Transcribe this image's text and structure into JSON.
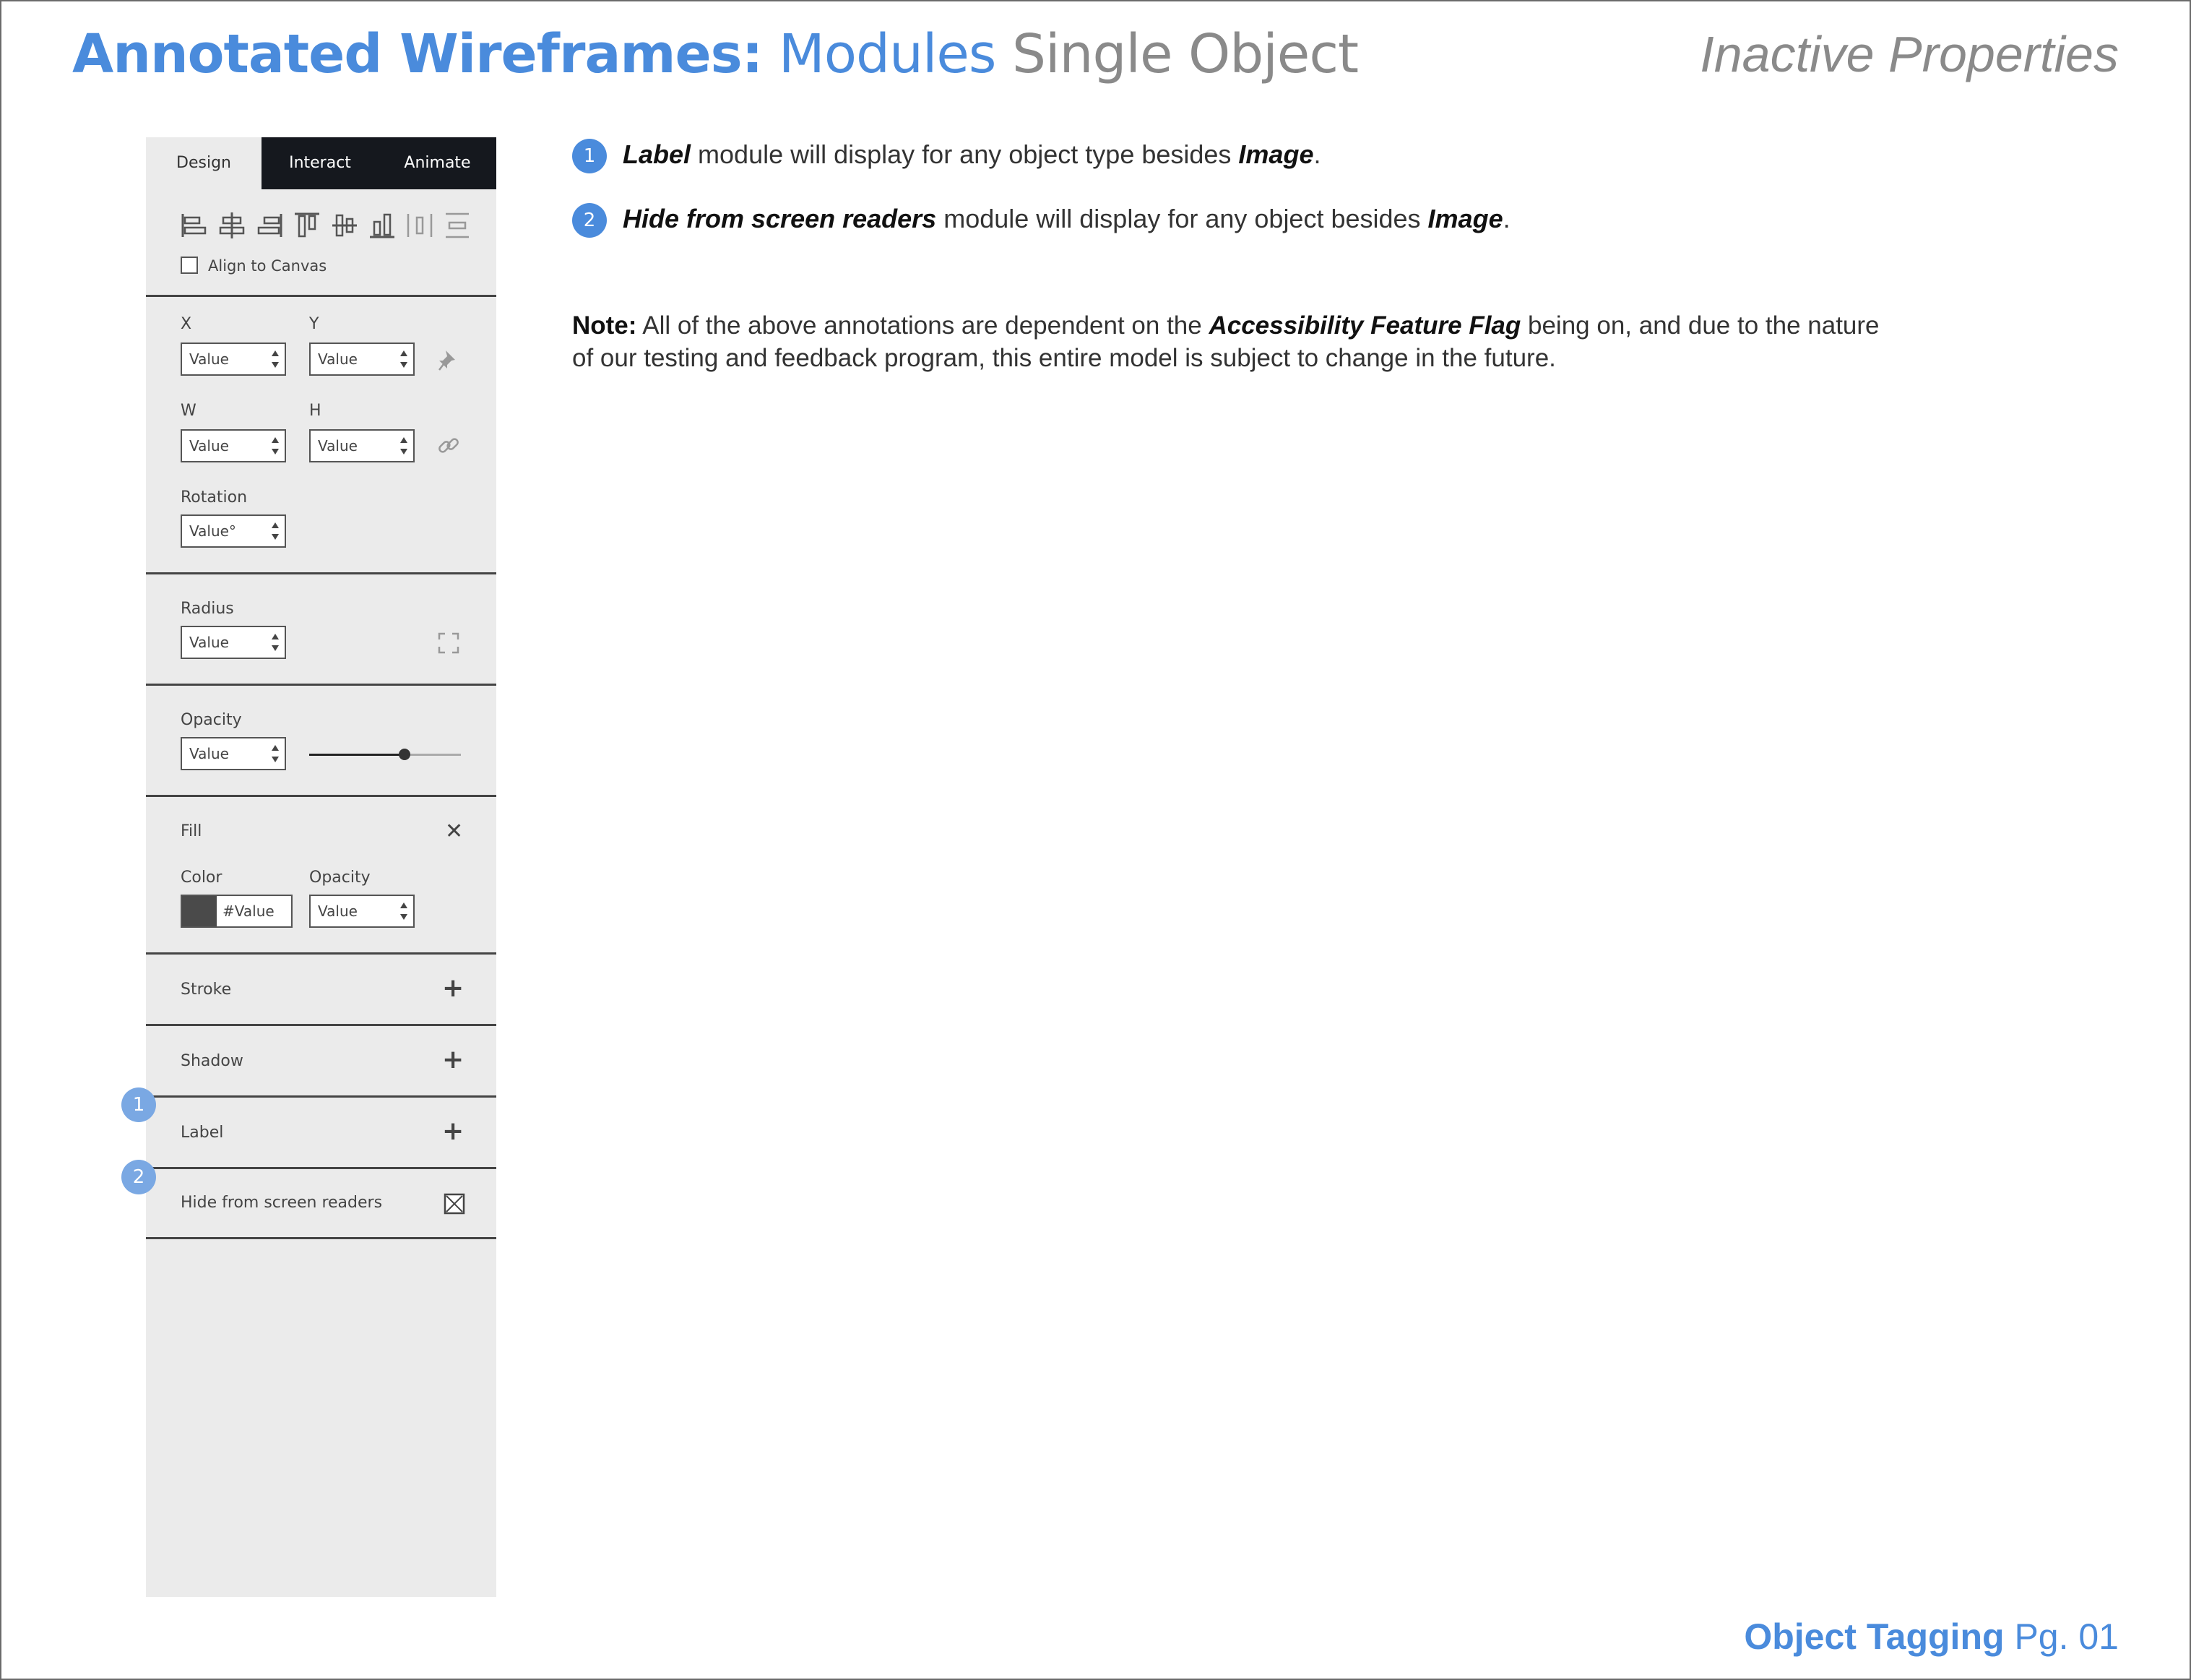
{
  "header": {
    "title_bold": "Annotated Wireframes:",
    "title_module": "Modules",
    "title_sub": "Single Object",
    "state": "Inactive Properties"
  },
  "panel": {
    "tabs": [
      "Design",
      "Interact",
      "Animate"
    ],
    "align_to_canvas": "Align to Canvas",
    "x_label": "X",
    "y_label": "Y",
    "w_label": "W",
    "h_label": "H",
    "rotation_label": "Rotation",
    "radius_label": "Radius",
    "opacity_label": "Opacity",
    "fill_label": "Fill",
    "color_label": "Color",
    "fill_opacity_label": "Opacity",
    "value": "Value",
    "rotation_value": "Value°",
    "color_value": "#Value",
    "opacity_slider_level": 0.63,
    "stroke_label": "Stroke",
    "shadow_label": "Shadow",
    "label_label": "Label",
    "hide_label": "Hide from screen readers",
    "markers": [
      "1",
      "2"
    ]
  },
  "annotations": [
    {
      "num": "1",
      "bold": "Label",
      "text": " module will display for any object type besides ",
      "bold2": "Image",
      "end": "."
    },
    {
      "num": "2",
      "bold": "Hide from screen readers",
      "text": " module will display for any object besides ",
      "bold2": "Image",
      "end": "."
    }
  ],
  "note": {
    "lead": "Note:",
    "text1": " All of the above annotations are dependent on the ",
    "flag": "Accessibility Feature Flag",
    "text2": " being on, and due to the nature of our testing and feedback program, this entire model is subject to change in the future."
  },
  "footer": {
    "section": "Object Tagging",
    "page": "Pg. 01"
  },
  "colors": {
    "accent": "#4a8bdc",
    "marker": "#7aa8e3",
    "tab_dark": "#15181e",
    "panel_bg": "#ebebeb"
  }
}
